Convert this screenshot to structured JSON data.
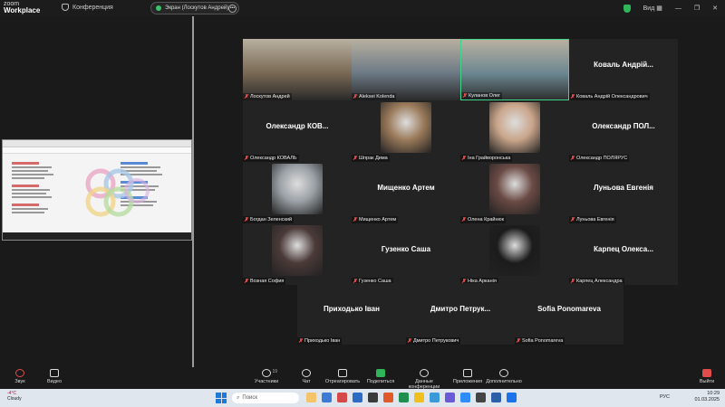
{
  "app": {
    "logo_line1": "zoom",
    "logo_line2": "Workplace",
    "conference_label": "Конференция",
    "screen_share_label": "Экран (Лоскутов Андрей)",
    "view_label": "Вид"
  },
  "video_grid": [
    {
      "name": "Лоскутов Андрей",
      "big": "",
      "kind": "video",
      "color": "#7a6a55"
    },
    {
      "name": "Aleksei Kolenda",
      "big": "",
      "kind": "video",
      "color": "#6d7a86"
    },
    {
      "name": "Куланов Олег",
      "big": "",
      "kind": "video",
      "color": "#6b8690",
      "active": true
    },
    {
      "name": "Коваль Андрій Олександрович",
      "big": "Коваль Андрій...",
      "kind": "name"
    },
    {
      "name": "Олександр КОВАЛЬ",
      "big": "Олександр КОВ...",
      "kind": "name"
    },
    {
      "name": "Шпрак Дима",
      "big": "",
      "kind": "photo",
      "color": "#9a7a5a"
    },
    {
      "name": "Іна Грайворонська",
      "big": "",
      "kind": "photo",
      "color": "#c9a58a"
    },
    {
      "name": "Олександр ПОЛЯРУС",
      "big": "Олександр ПОЛ...",
      "kind": "name"
    },
    {
      "name": "Богдан Зеленский",
      "big": "",
      "kind": "photo",
      "color": "#9aa0a6"
    },
    {
      "name": "Мищенко Артем",
      "big": "Мищенко Артем",
      "kind": "name"
    },
    {
      "name": "Олена Крайнюк",
      "big": "",
      "kind": "photo",
      "color": "#6a4a44"
    },
    {
      "name": "Луньова Евгенія",
      "big": "Луньова Евгенія",
      "kind": "name"
    },
    {
      "name": "Возная София",
      "big": "",
      "kind": "photo",
      "color": "#4a3a38"
    },
    {
      "name": "Гузенко Саша",
      "big": "Гузенко Саша",
      "kind": "name"
    },
    {
      "name": "Ніка Арканія",
      "big": "",
      "kind": "photo",
      "color": "#1c1c1c"
    },
    {
      "name": "Карпец Александра",
      "big": "Карпец Олекса...",
      "kind": "name"
    }
  ],
  "video_grid_row5": [
    {
      "name": "Приходько Іван",
      "big": "Приходько Іван"
    },
    {
      "name": "Дмитро Петрукович",
      "big": "Дмитро Петрук..."
    },
    {
      "name": "Sofia Ponomareva",
      "big": "Sofia Ponomareva"
    }
  ],
  "toolbar": {
    "audio": "Звук",
    "video": "Видео",
    "participants": "Участники",
    "participants_count": "19",
    "chat": "Чат",
    "react": "Отреагировать",
    "share": "Поделиться",
    "meeting_data": "Данные конференции",
    "apps": "Приложения",
    "more": "Дополнительно",
    "leave": "Выйти"
  },
  "taskbar": {
    "temp": "-4°C",
    "weather": "Cloudy",
    "search_placeholder": "Поиск",
    "lang": "РУС",
    "time": "10:29",
    "date": "01.03.2025"
  },
  "colors": {
    "accent_green": "#2fb65a",
    "muted_red": "#e04b4b",
    "active_border": "#3fd48a"
  }
}
